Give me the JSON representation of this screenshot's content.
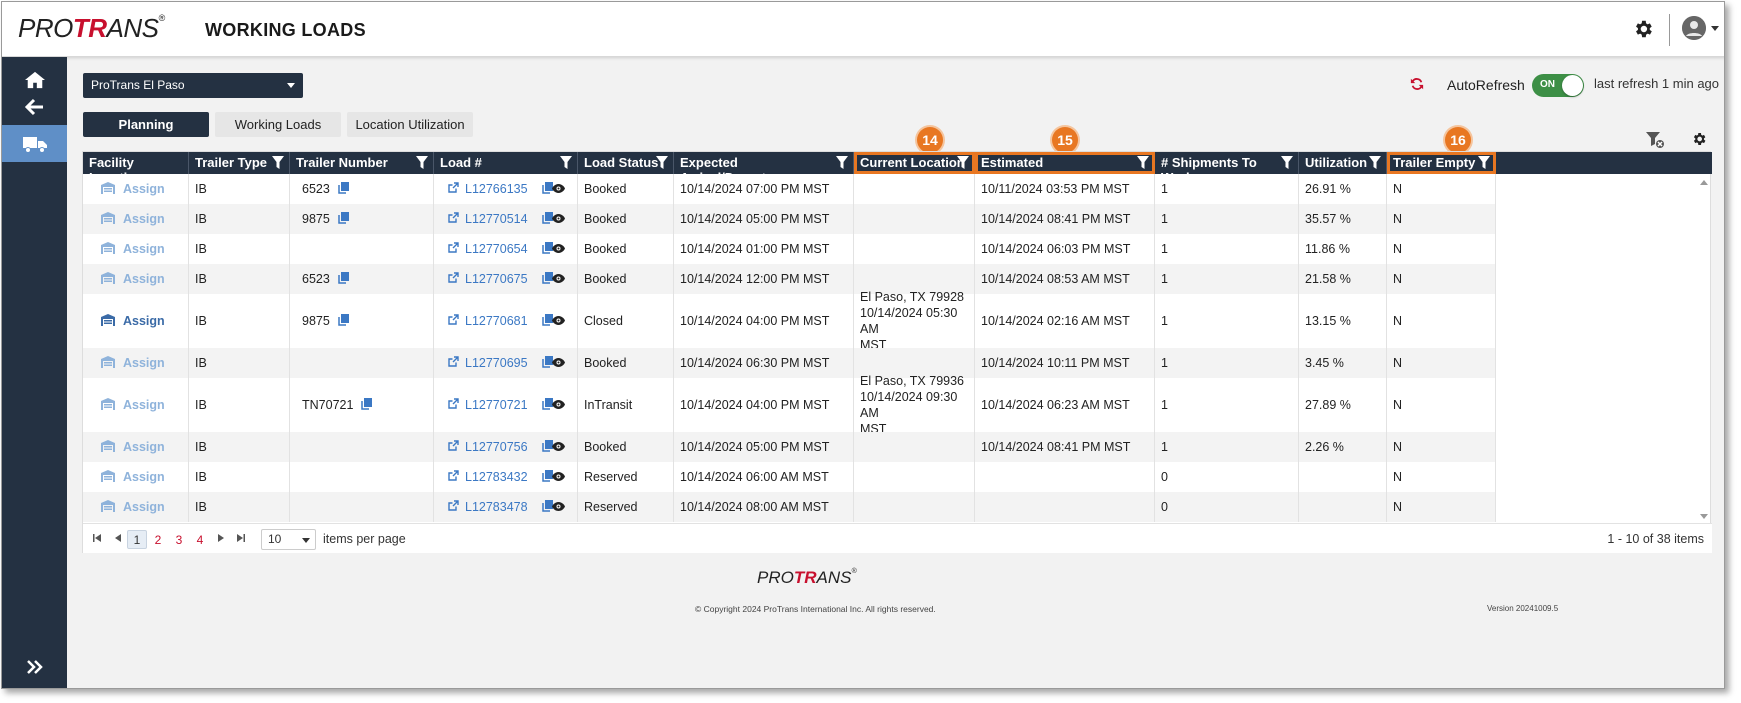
{
  "header": {
    "logo_prefix": "PRO",
    "logo_accent": "TR",
    "logo_suffix": "ANS",
    "logo_mark": "®",
    "title": "WORKING LOADS"
  },
  "controls": {
    "facility": "ProTrans El Paso",
    "autorefresh_label": "AutoRefresh",
    "toggle_state": "ON",
    "last_refresh": "last refresh 1 min ago"
  },
  "tabs": [
    {
      "label": "Planning",
      "active": true
    },
    {
      "label": "Working Loads",
      "active": false
    },
    {
      "label": "Location Utilization",
      "active": false
    }
  ],
  "columns": [
    "Facility Location",
    "Trailer Type",
    "Trailer Number",
    "Load #",
    "Load Status",
    "Expected Arrival/Departure",
    "Current Location",
    "Estimated Arrival/Departure",
    "# Shipments To Work",
    "Utilization",
    "Trailer Empty"
  ],
  "callouts": [
    "14",
    "15",
    "16"
  ],
  "assign_label": "Assign",
  "rows": [
    {
      "trailer_type": "IB",
      "trailer_number": "6523",
      "load": "L12766135",
      "status": "Booked",
      "expected": "10/14/2024 07:00 PM MST",
      "current_location": "",
      "current_location_2": "",
      "current_location_3": "",
      "estimated": "10/11/2024 03:53 PM MST",
      "shipments": "1",
      "utilization": "26.91 %",
      "trailer_empty": "N"
    },
    {
      "trailer_type": "IB",
      "trailer_number": "9875",
      "load": "L12770514",
      "status": "Booked",
      "expected": "10/14/2024 05:00 PM MST",
      "current_location": "",
      "current_location_2": "",
      "current_location_3": "",
      "estimated": "10/14/2024 08:41 PM MST",
      "shipments": "1",
      "utilization": "35.57 %",
      "trailer_empty": "N"
    },
    {
      "trailer_type": "IB",
      "trailer_number": "",
      "load": "L12770654",
      "status": "Booked",
      "expected": "10/14/2024 01:00 PM MST",
      "current_location": "",
      "current_location_2": "",
      "current_location_3": "",
      "estimated": "10/14/2024 06:03 PM MST",
      "shipments": "1",
      "utilization": "11.86 %",
      "trailer_empty": "N"
    },
    {
      "trailer_type": "IB",
      "trailer_number": "6523",
      "load": "L12770675",
      "status": "Booked",
      "expected": "10/14/2024 12:00 PM MST",
      "current_location": "",
      "current_location_2": "",
      "current_location_3": "",
      "estimated": "10/14/2024 08:53 AM MST",
      "shipments": "1",
      "utilization": "21.58 %",
      "trailer_empty": "N"
    },
    {
      "trailer_type": "IB",
      "trailer_number": "9875",
      "load": "L12770681",
      "status": "Closed",
      "expected": "10/14/2024 04:00 PM MST",
      "current_location": "El Paso, TX 79928",
      "current_location_2": "10/14/2024 05:30 AM",
      "current_location_3": "MST",
      "estimated": "10/14/2024 02:16 AM MST",
      "shipments": "1",
      "utilization": "13.15 %",
      "trailer_empty": "N"
    },
    {
      "trailer_type": "IB",
      "trailer_number": "",
      "load": "L12770695",
      "status": "Booked",
      "expected": "10/14/2024 06:30 PM MST",
      "current_location": "",
      "current_location_2": "",
      "current_location_3": "",
      "estimated": "10/14/2024 10:11 PM MST",
      "shipments": "1",
      "utilization": "3.45 %",
      "trailer_empty": "N"
    },
    {
      "trailer_type": "IB",
      "trailer_number": "TN70721",
      "load": "L12770721",
      "status": "InTransit",
      "expected": "10/14/2024 04:00 PM MST",
      "current_location": "El Paso, TX 79936",
      "current_location_2": "10/14/2024 09:30 AM",
      "current_location_3": "MST",
      "estimated": "10/14/2024 06:23 AM MST",
      "shipments": "1",
      "utilization": "27.89 %",
      "trailer_empty": "N"
    },
    {
      "trailer_type": "IB",
      "trailer_number": "",
      "load": "L12770756",
      "status": "Booked",
      "expected": "10/14/2024 05:00 PM MST",
      "current_location": "",
      "current_location_2": "",
      "current_location_3": "",
      "estimated": "10/14/2024 08:41 PM MST",
      "shipments": "1",
      "utilization": "2.26 %",
      "trailer_empty": "N"
    },
    {
      "trailer_type": "IB",
      "trailer_number": "",
      "load": "L12783432",
      "status": "Reserved",
      "expected": "10/14/2024 06:00 AM MST",
      "current_location": "",
      "current_location_2": "",
      "current_location_3": "",
      "estimated": "",
      "shipments": "0",
      "utilization": "",
      "trailer_empty": "N"
    },
    {
      "trailer_type": "IB",
      "trailer_number": "",
      "load": "L12783478",
      "status": "Reserved",
      "expected": "10/14/2024 08:00 AM MST",
      "current_location": "",
      "current_location_2": "",
      "current_location_3": "",
      "estimated": "",
      "shipments": "0",
      "utilization": "",
      "trailer_empty": "N"
    }
  ],
  "pager": {
    "pages": [
      "1",
      "2",
      "3",
      "4"
    ],
    "page_size": "10",
    "items_per_page": "items per page",
    "info": "1 - 10 of 38 items"
  },
  "footer": {
    "copyright": "© Copyright 2024 ProTrans International Inc. All rights reserved.",
    "version": "Version 20241009.5"
  },
  "colors": {
    "navy": "#243142",
    "accent_orange": "#e87722",
    "brand_red": "#c8102e",
    "link_blue": "#3b78c4",
    "toggle_green": "#3d8f46"
  }
}
